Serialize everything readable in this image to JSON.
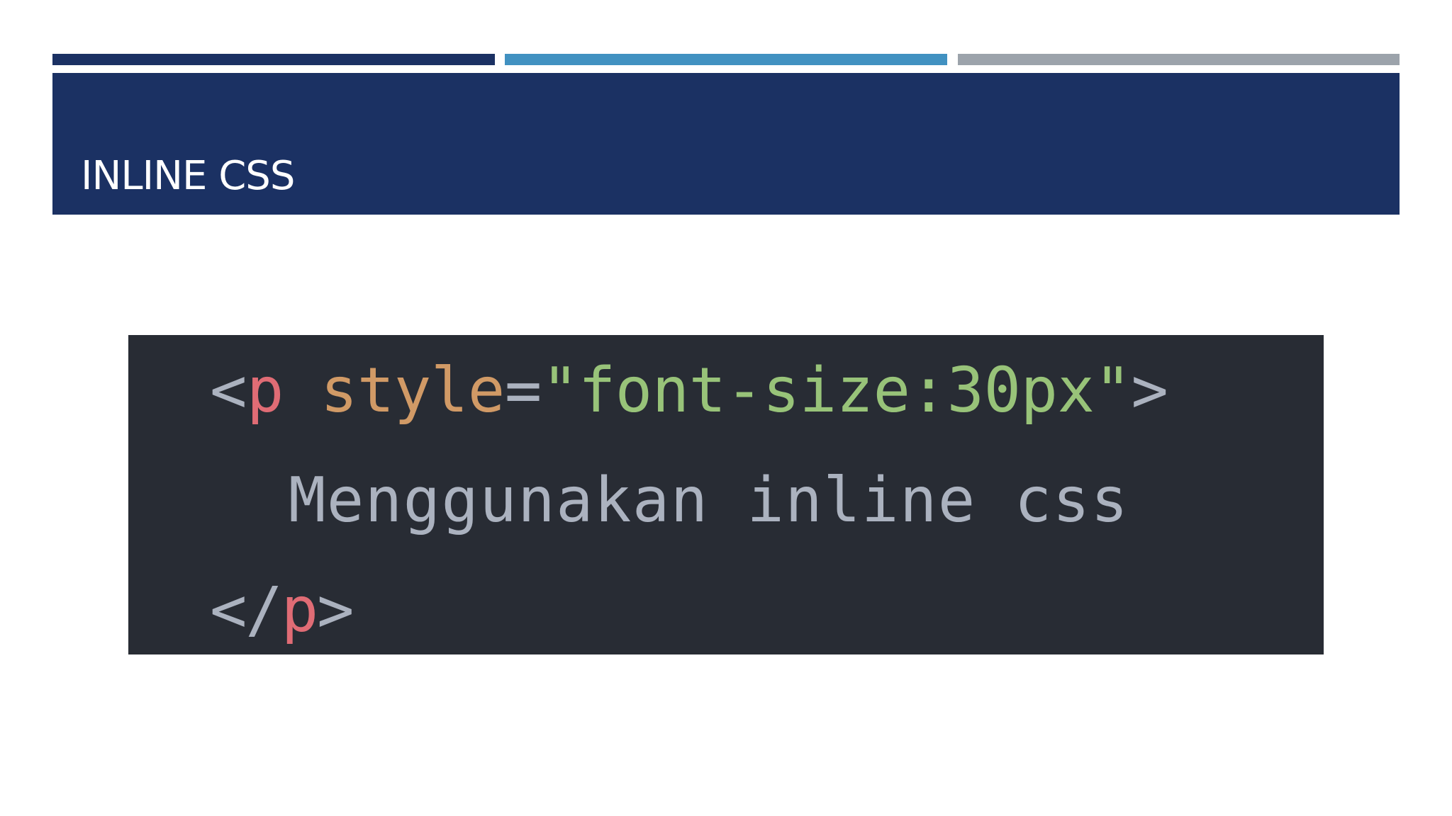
{
  "slide": {
    "title": "INLINE CSS",
    "colors": {
      "background": "#ffffff",
      "banner": "#1b3163",
      "accent_dark_blue": "#1b3163",
      "accent_light_blue": "#4191c1",
      "accent_gray": "#9ca3ab",
      "code_background": "#282c34"
    },
    "accent_bars": [
      {
        "name": "dark-blue",
        "color": "#1b3163"
      },
      {
        "name": "light-blue",
        "color": "#4191c1"
      },
      {
        "name": "gray",
        "color": "#9ca3ab"
      }
    ]
  },
  "code_snippet": {
    "background": "#282c34",
    "lines": [
      {
        "tokens": [
          {
            "text": "<",
            "color": "#abb2bf",
            "role": "punctuation"
          },
          {
            "text": "p",
            "color": "#e06c75",
            "role": "tag"
          },
          {
            "text": " ",
            "color": "#abb2bf",
            "role": "whitespace"
          },
          {
            "text": "style",
            "color": "#d19a66",
            "role": "attribute"
          },
          {
            "text": "=",
            "color": "#abb2bf",
            "role": "operator"
          },
          {
            "text": "\"font-size:30px\"",
            "color": "#98c379",
            "role": "string"
          },
          {
            "text": ">",
            "color": "#abb2bf",
            "role": "punctuation"
          }
        ]
      },
      {
        "tokens": [
          {
            "text": "Menggunakan inline css",
            "color": "#abb2bf",
            "role": "text"
          }
        ]
      },
      {
        "tokens": [
          {
            "text": "</",
            "color": "#abb2bf",
            "role": "punctuation"
          },
          {
            "text": "p",
            "color": "#e06c75",
            "role": "tag"
          },
          {
            "text": ">",
            "color": "#abb2bf",
            "role": "punctuation"
          }
        ]
      }
    ]
  }
}
